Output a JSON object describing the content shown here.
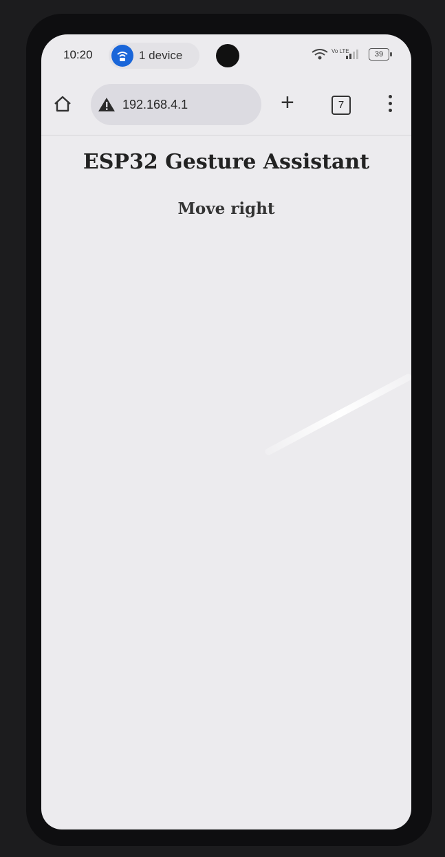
{
  "status_bar": {
    "time": "10:20",
    "hotspot_label": "1 device",
    "network_label": "Vo LTE",
    "battery": "39"
  },
  "browser": {
    "url": "192.168.4.1",
    "tab_count": "7",
    "icons": {
      "home": "home-icon",
      "security": "warning-icon",
      "new_tab": "plus-icon",
      "tabs": "tab-switcher-icon",
      "menu": "more-vert-icon"
    }
  },
  "page": {
    "title": "ESP32 Gesture Assistant",
    "message": "Move right"
  },
  "colors": {
    "hotspot_accent": "#1a66d9",
    "page_background": "#ecebee",
    "text": "#222222"
  }
}
